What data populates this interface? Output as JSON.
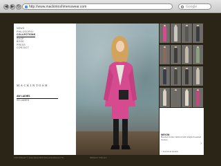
{
  "browser": {
    "url": "http://www.mackintoshmenswear.com",
    "search_placeholder": "Google",
    "back_glyph": "◀",
    "forward_glyph": "▶",
    "reload_glyph": "↻"
  },
  "nav": {
    "items": [
      {
        "label": "NEWS",
        "active": false
      },
      {
        "label": "PHILOSOPHY",
        "active": false
      },
      {
        "label": "COLLECTIONS",
        "active": true
      },
      {
        "label": "SHOP",
        "active": false
      },
      {
        "label": "BOOK",
        "active": false
      },
      {
        "label": "PRESS",
        "active": false
      },
      {
        "label": "CONTACT",
        "active": false
      }
    ]
  },
  "logo": "MACKINTOSH",
  "subnav": {
    "items": [
      {
        "label": "AW LADIES",
        "active": true
      },
      {
        "label": "SS LADIES",
        "active": false
      }
    ]
  },
  "product": {
    "title": "NEVON",
    "description": "Bonded Cotton tailored with single-breasted closure",
    "link": "< Technical Details",
    "arrow": "›"
  },
  "thumbnails": [
    {
      "coat": "#d64b8f"
    },
    {
      "coat": "#c9c6bf"
    },
    {
      "coat": "#5a5650"
    },
    {
      "coat": "#3b3b3b"
    },
    {
      "coat": "#8a6a5a"
    },
    {
      "coat": "#3e3d3a"
    },
    {
      "coat": "#c2b8a8"
    },
    {
      "coat": "#8aa07e"
    },
    {
      "coat": "#3a3d48"
    },
    {
      "coat": "#4b4843"
    },
    {
      "coat": "#3c3a36"
    },
    {
      "coat": "#c8bfb0"
    },
    {
      "coat": "#d9d2c2"
    },
    {
      "coat": "#6f6a62"
    },
    {
      "coat": "#e0d7c6"
    },
    {
      "coat": "#c0487e"
    }
  ],
  "footer": {
    "left": "COPYRIGHT © 2010 MACKINTOSH HOLDINGS LTD.",
    "right": "PRIVACY POLICY"
  },
  "colors": {
    "background": "#2b2517",
    "accent_coat": "#d64b8f"
  }
}
